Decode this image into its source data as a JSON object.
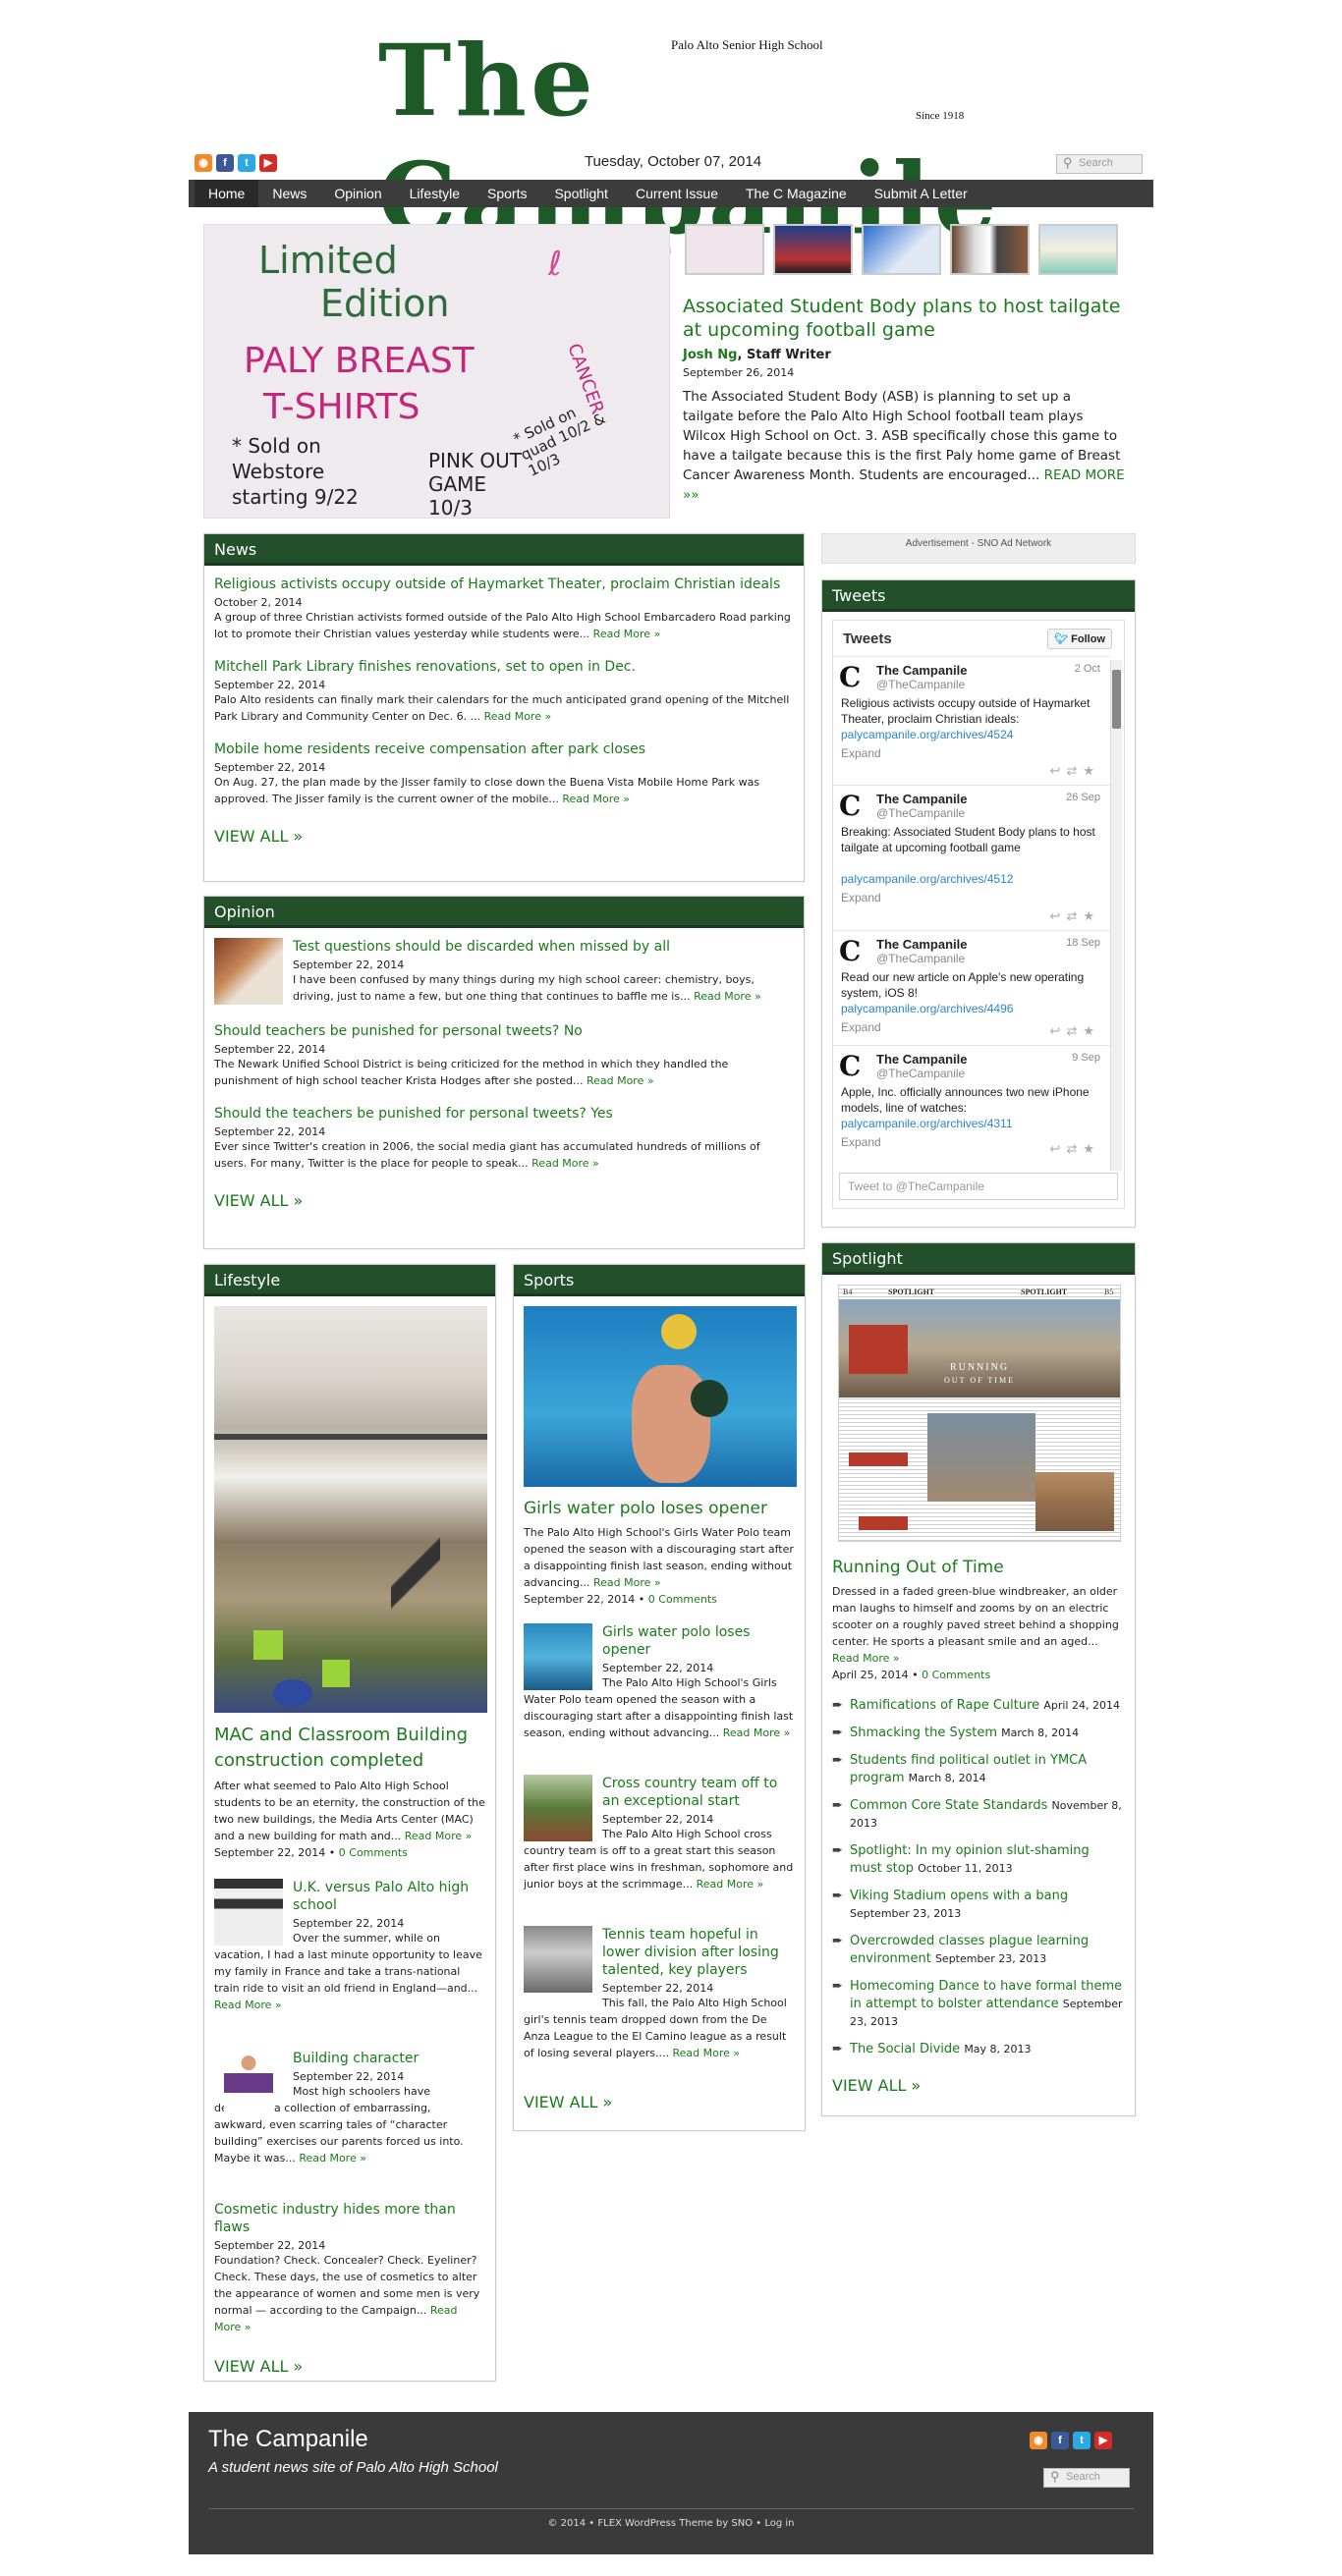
{
  "masthead": {
    "title": "The Campanile",
    "tagline": "Palo Alto Senior High School",
    "since": "Since 1918"
  },
  "top": {
    "date": "Tuesday, October 07, 2014",
    "search_placeholder": "Search"
  },
  "nav": {
    "items": [
      "Home",
      "News",
      "Opinion",
      "Lifestyle",
      "Sports",
      "Spotlight",
      "Current Issue",
      "The C Magazine",
      "Submit A Letter"
    ]
  },
  "feature": {
    "image_text": [
      "Limited",
      "Edition",
      "PALY BREAST",
      "CANCER",
      "T-SHIRTS",
      "* Sold on Webstore starting 9/22",
      "* Sold on quad 10/2 & 10/3",
      "PINK OUT GAME 10/3"
    ],
    "title": "Associated Student Body plans to host tailgate at upcoming football game",
    "author": "Josh Ng",
    "role": ", Staff Writer",
    "date": "September 26, 2014",
    "excerpt": "The Associated Student Body (ASB) is planning to set up a tailgate before the Palo Alto High School football team plays Wilcox High School on Oct. 3. ASB specifically chose this game to have a tailgate because this is the first Paly home game of Breast Cancer Awareness Month. Students are encouraged...",
    "read_more": "READ MORE »»"
  },
  "news": {
    "heading": "News",
    "items": [
      {
        "title": "Religious activists occupy outside of Haymarket Theater, proclaim Christian ideals",
        "date": "October 2, 2014",
        "excerpt": "A group of three Christian activists formed outside of the Palo Alto High School Embarcadero Road parking lot to promote their Christian values yesterday while students were...",
        "more": "Read More »"
      },
      {
        "title": "Mitchell Park Library finishes renovations, set to open in Dec.",
        "date": "September 22, 2014",
        "excerpt": "Palo Alto residents can finally mark their calendars for the much anticipated grand opening of the Mitchell Park Library and Community Center on Dec. 6. ...",
        "more": "Read More »"
      },
      {
        "title": "Mobile home residents receive compensation after park closes",
        "date": "September 22, 2014",
        "excerpt": "On Aug. 27, the plan made by the Jisser family to close down the Buena Vista Mobile Home Park was approved. The Jisser family is the current owner of the mobile...",
        "more": "Read More »"
      }
    ],
    "view_all": "VIEW ALL »"
  },
  "opinion": {
    "heading": "Opinion",
    "items": [
      {
        "title": "Test questions should be discarded when missed by all",
        "date": "September 22, 2014",
        "excerpt": "I have been confused by many things during my high school career: chemistry, boys, driving, just to name a few, but one thing that continues to baffle me is...",
        "more": "Read More »"
      },
      {
        "title": "Should teachers be punished for personal tweets? No",
        "date": "September 22, 2014",
        "excerpt": "The Newark Unified School District is being criticized for the method in which they handled the punishment of high school teacher Krista Hodges after she posted...",
        "more": "Read More »"
      },
      {
        "title": "Should the teachers be punished for personal tweets? Yes",
        "date": "September 22, 2014",
        "excerpt": "Ever since Twitter's creation in 2006, the social media giant has accumulated hundreds of millions of users. For many, Twitter is the place for people to speak...",
        "more": "Read More »"
      }
    ],
    "view_all": "VIEW ALL »"
  },
  "ad": {
    "label": "Advertisement - SNO Ad Network"
  },
  "tweets": {
    "heading": "Tweets",
    "widget_title": "Tweets",
    "follow": "Follow",
    "compose": "Tweet to @TheCampanile",
    "items": [
      {
        "name": "The Campanile",
        "handle": "@TheCampanile",
        "date": "2 Oct",
        "text": "Religious activists occupy outside of Haymarket Theater, proclaim Christian ideals:",
        "link": "palycampanile.org/archives/4524",
        "expand": "Expand"
      },
      {
        "name": "The Campanile",
        "handle": "@TheCampanile",
        "date": "26 Sep",
        "text": "Breaking: Associated Student Body plans to host tailgate at upcoming football game",
        "link": "palycampanile.org/archives/4512",
        "expand": "Expand"
      },
      {
        "name": "The Campanile",
        "handle": "@TheCampanile",
        "date": "18 Sep",
        "text": "Read our new article on Apple's new operating system, iOS 8!",
        "link": "palycampanile.org/archives/4496",
        "expand": "Expand"
      },
      {
        "name": "The Campanile",
        "handle": "@TheCampanile",
        "date": "9 Sep",
        "text": "Apple, Inc. officially announces two new iPhone models, line of watches:",
        "link": "palycampanile.org/archives/4311",
        "expand": "Expand"
      }
    ]
  },
  "lifestyle": {
    "heading": "Lifestyle",
    "main": {
      "title": "MAC and Classroom Building construction completed",
      "excerpt": "After what seemed to Palo Alto High School students to be an eternity, the construction of the two new buildings, the Media Arts Center (MAC) and a new building for math and...",
      "more": "Read More »",
      "date": "September 22, 2014",
      "comments": "0 Comments"
    },
    "items": [
      {
        "title": "U.K. versus Palo Alto high school",
        "date": "September 22, 2014",
        "excerpt": "Over the summer, while on vacation, I had a last minute opportunity to leave my family in France and take a trans-national train ride to visit an old friend in England—and...",
        "more": "Read More »"
      },
      {
        "title": "Building character",
        "date": "September 22, 2014",
        "excerpt": "Most high schoolers have developed a collection of embarrassing, awkward, even scarring tales of “character building” exercises our parents forced us into. Maybe it was...",
        "more": "Read More »"
      },
      {
        "title": "Cosmetic industry hides more than flaws",
        "date": "September 22, 2014",
        "excerpt": "Foundation? Check. Concealer? Check. Eyeliner? Check. These days, the use of cosmetics to alter the appearance of women and some men is very normal — according to the Campaign...",
        "more": "Read More »"
      }
    ],
    "view_all": "VIEW ALL »"
  },
  "sports": {
    "heading": "Sports",
    "main": {
      "title": "Girls water polo loses opener",
      "excerpt": "The Palo Alto High School's Girls Water Polo team opened the season with a discouraging start after a disappointing finish last season, ending without advancing...",
      "more": "Read More »",
      "date": "September 22, 2014",
      "comments": "0 Comments"
    },
    "items": [
      {
        "title": "Girls water polo loses opener",
        "date": "September 22, 2014",
        "excerpt": "The Palo Alto High School's Girls Water Polo team opened the season with a discouraging start after a disappointing finish last season, ending without advancing...",
        "more": "Read More »"
      },
      {
        "title": "Cross country team off to an exceptional start",
        "date": "September 22, 2014",
        "excerpt": "The Palo Alto High School cross country team is off to a great start this season after first place wins in freshman, sophomore and junior boys at the scrimmage...",
        "more": "Read More »"
      },
      {
        "title": "Tennis team hopeful in lower division after losing talented, key players",
        "date": "September 22, 2014",
        "excerpt": "This fall, the Palo Alto High School girl's tennis team dropped down from the De Anza League to the El Camino league as a result of losing several players....",
        "more": "Read More »"
      }
    ],
    "view_all": "VIEW ALL »"
  },
  "spotlight": {
    "heading": "Spotlight",
    "cover_text": [
      "B4",
      "SPOTLIGHT",
      "SPOTLIGHT",
      "B5",
      "RUNNING",
      "OUT OF TIME"
    ],
    "main": {
      "title": "Running Out of Time",
      "excerpt": "Dressed in a faded green-blue windbreaker, an older man laughs to himself and zooms by on an electric scooter on a roughly paved street behind a shopping center. He sports a pleasant smile and an aged...",
      "more": "Read More »",
      "date": "April 25, 2014",
      "comments": "0 Comments"
    },
    "links": [
      {
        "title": "Ramifications of Rape Culture",
        "date": "April 24, 2014"
      },
      {
        "title": "Shmacking the System",
        "date": "March 8, 2014"
      },
      {
        "title": "Students find political outlet in YMCA program",
        "date": "March 8, 2014"
      },
      {
        "title": "Common Core State Standards",
        "date": "November 8, 2013"
      },
      {
        "title": "Spotlight: In my opinion slut-shaming must stop",
        "date": "October 11, 2013"
      },
      {
        "title": "Viking Stadium opens with a bang",
        "date": "September 23, 2013"
      },
      {
        "title": "Overcrowded classes plague learning environment",
        "date": "September 23, 2013"
      },
      {
        "title": "Homecoming Dance to have formal theme in attempt to bolster attendance",
        "date": "September 23, 2013"
      },
      {
        "title": "The Social Divide",
        "date": "May 8, 2013"
      }
    ],
    "view_all": "VIEW ALL »"
  },
  "footer": {
    "title": "The Campanile",
    "tagline": "A student news site of Palo Alto High School",
    "search_placeholder": "Search",
    "copyright": "© 2014 • FLEX WordPress Theme by SNO • Log in"
  },
  "colors": {
    "green": "#23502b",
    "link": "#1b7a1b",
    "nav": "#3c3c3c",
    "footer": "#3a3a3a"
  }
}
